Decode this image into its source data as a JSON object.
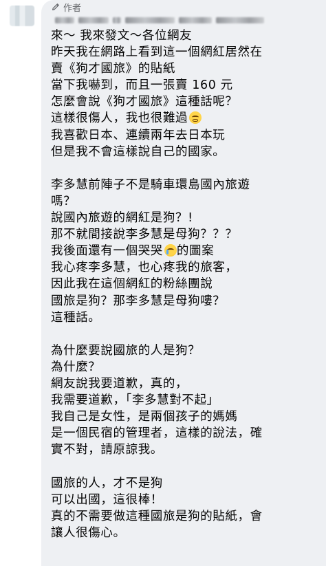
{
  "header": {
    "author_label": "作者",
    "author_icon": "pen-icon"
  },
  "post": {
    "lines": [
      "來～ 我來發文～各位網友",
      "昨天我在網路上看到這一個網紅居然在",
      "賣《狗才國旅》的貼紙",
      "當下我嚇到，而且一張賣 160 元",
      "怎麼會說《狗才國旅》這種話呢？",
      "這樣很傷人，我也很難過",
      "我喜歡日本、連續兩年去日本玩",
      "但是我不會這樣說自己的國家。",
      "",
      "李多慧前陣子不是騎車環島國內旅遊",
      "嗎？",
      "說國內旅遊的網紅是狗？!",
      "那不就間接說李多慧是母狗？？？",
      "我後面還有一個哭哭",
      "我心疼李多慧，也心疼我的旅客，",
      "因此我在這個網紅的粉絲團說",
      "國旅是狗？那李多慧是母狗嘍？",
      "這種話。",
      "",
      "為什麼要說國旅的人是狗？",
      "為什麼？",
      "網友說我要道歉，真的，",
      "我需要道歉，「李多慧對不起」",
      "我自己是女性，是兩個孩子的媽媽",
      "是一個民宿的管理者，這樣的說法，確",
      "實不對，請原諒我。",
      "",
      "國旅的人，才不是狗",
      "可以出國，這很棒！",
      "真的不需要做這種國旅是狗的貼紙，會",
      "讓人很傷心。"
    ],
    "line_13_suffix": "的圖案",
    "emoji_line5": "weary-face-emoji",
    "emoji_line13": "crying-face-emoji"
  }
}
